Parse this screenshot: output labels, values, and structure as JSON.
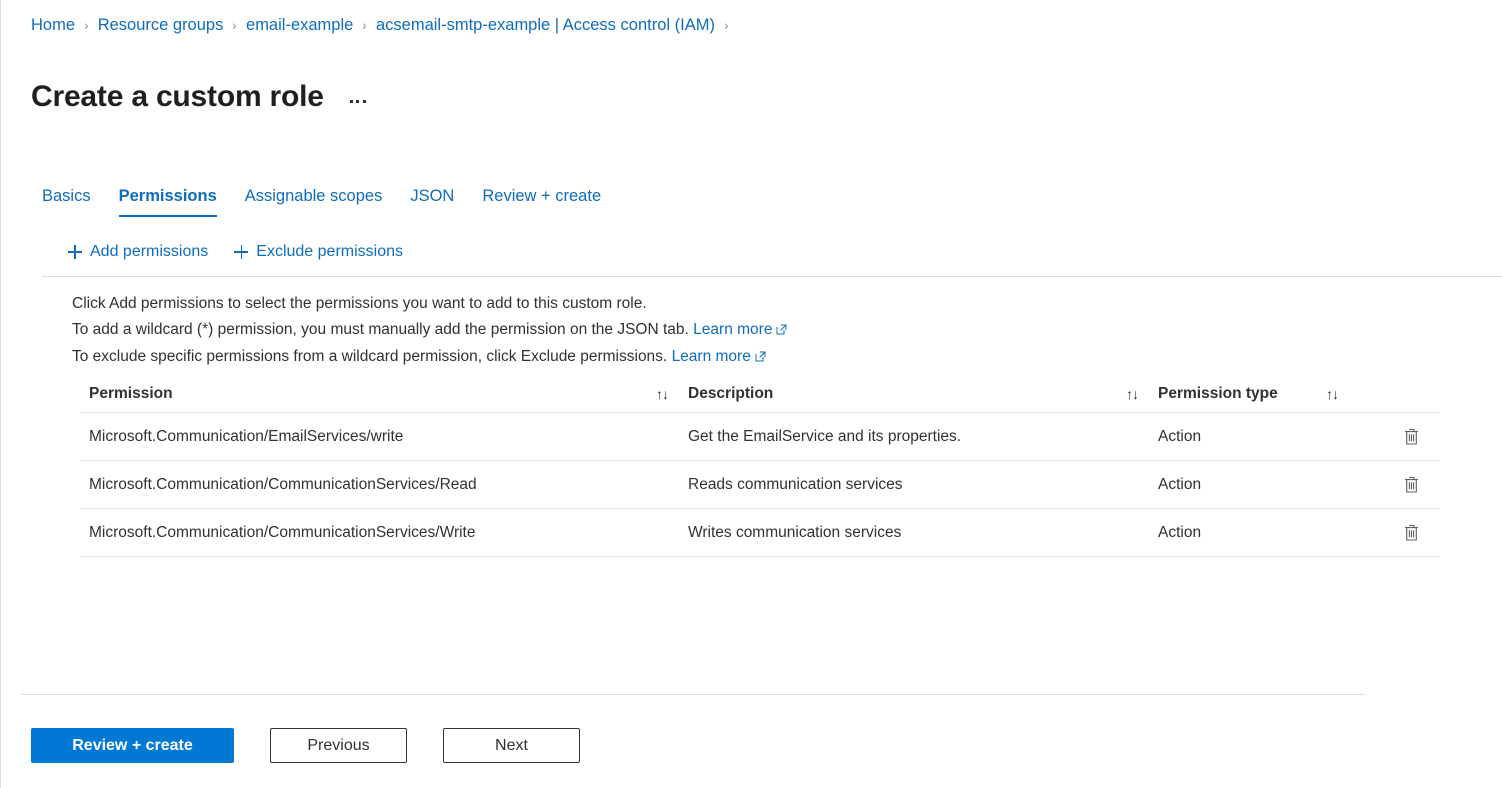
{
  "breadcrumb": {
    "items": [
      {
        "label": "Home"
      },
      {
        "label": "Resource groups"
      },
      {
        "label": "email-example"
      },
      {
        "label": "acsemail-smtp-example | Access control (IAM)"
      }
    ],
    "separator": "›"
  },
  "header": {
    "title": "Create a custom role",
    "more_menu_name": "more-options"
  },
  "tabs": [
    {
      "label": "Basics",
      "active": false
    },
    {
      "label": "Permissions",
      "active": true
    },
    {
      "label": "Assignable scopes",
      "active": false
    },
    {
      "label": "JSON",
      "active": false
    },
    {
      "label": "Review + create",
      "active": false
    }
  ],
  "command_bar": [
    {
      "label": "Add permissions",
      "icon": "plus-icon"
    },
    {
      "label": "Exclude permissions",
      "icon": "plus-icon"
    }
  ],
  "description": {
    "line1": "Click Add permissions to select the permissions you want to add to this custom role.",
    "line2_text": "To add a wildcard (*) permission, you must manually add the permission on the JSON tab.",
    "line2_link": "Learn more",
    "line3_text": "To exclude specific permissions from a wildcard permission, click Exclude permissions.",
    "line3_link": "Learn more"
  },
  "table": {
    "columns": [
      {
        "label": "Permission",
        "sort_icon": "↑↓"
      },
      {
        "label": "Description",
        "sort_icon": "↑↓"
      },
      {
        "label": "Permission type",
        "sort_icon": "↑↓"
      }
    ],
    "rows": [
      {
        "permission": "Microsoft.Communication/EmailServices/write",
        "description": "Get the EmailService and its properties.",
        "type": "Action",
        "delete_icon": "trash-icon"
      },
      {
        "permission": "Microsoft.Communication/CommunicationServices/Read",
        "description": "Reads communication services",
        "type": "Action",
        "delete_icon": "trash-icon"
      },
      {
        "permission": "Microsoft.Communication/CommunicationServices/Write",
        "description": "Writes communication services",
        "type": "Action",
        "delete_icon": "trash-icon"
      }
    ]
  },
  "footer": {
    "primary": "Review + create",
    "previous": "Previous",
    "next": "Next"
  },
  "colors": {
    "accent": "#0078d4",
    "link": "#0f6cbd",
    "text": "#323130",
    "border": "#e1dfdd",
    "row_border": "#edebe9"
  }
}
